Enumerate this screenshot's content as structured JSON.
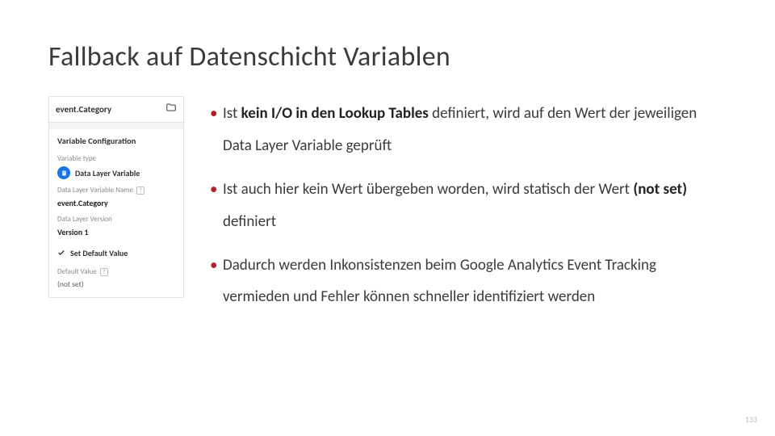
{
  "title": "Fallback auf Datenschicht Variablen",
  "sidebar": {
    "tile_label": "event.Category",
    "panel_title": "Variable Configuration",
    "var_type_label": "Variable type",
    "var_type_value": "Data Layer Variable",
    "dlv_name_label": "Data Layer Variable Name",
    "dlv_name_value": "event.Category",
    "dlv_version_label": "Data Layer Version",
    "dlv_version_value": "Version 1",
    "set_default_label": "Set Default Value",
    "default_value_label": "Default Value",
    "default_value_value": "(not set)"
  },
  "bullets": {
    "b1_a": "Ist ",
    "b1_bold": "kein I/O in den Lookup Tables",
    "b1_b": " definiert, wird auf den Wert der jeweiligen Data Layer Variable geprüft",
    "b2_a": "Ist auch hier kein Wert übergeben worden, wird statisch der Wert ",
    "b2_bold": "(not set)",
    "b2_b": " definiert",
    "b3": "Dadurch werden Inkonsistenzen beim Google Analytics Event Tracking vermieden und Fehler können schneller identifiziert werden"
  },
  "page_number": "133"
}
